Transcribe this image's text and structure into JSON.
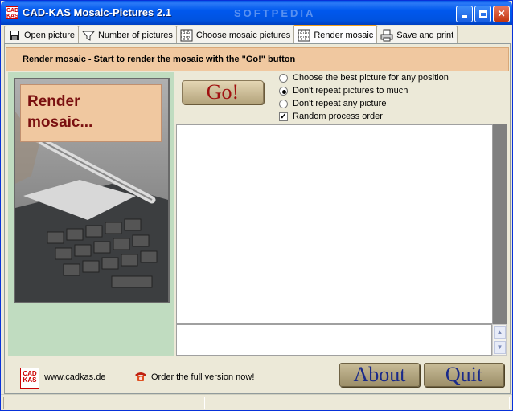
{
  "window": {
    "title": "CAD-KAS Mosaic-Pictures 2.1",
    "watermark": "SOFTPEDIA"
  },
  "app_icon": {
    "label": "CAD KAS"
  },
  "tabs": [
    {
      "label": "Open picture",
      "icon": "floppy-icon",
      "active": false
    },
    {
      "label": "Number of pictures",
      "icon": "funnel-icon",
      "active": false
    },
    {
      "label": "Choose mosaic pictures",
      "icon": "mosaic-grid-icon",
      "active": false
    },
    {
      "label": "Render mosaic",
      "icon": "mosaic-grid-icon",
      "active": true
    },
    {
      "label": "Save and print",
      "icon": "printer-icon",
      "active": false
    }
  ],
  "banner": {
    "text": "Render mosaic - Start to render the mosaic with the \"Go!\" button"
  },
  "preview": {
    "title_line1": "Render",
    "title_line2": "mosaic..."
  },
  "go_button": {
    "label": "Go!"
  },
  "options": [
    {
      "label": "Choose the best picture for any position",
      "type": "radio",
      "checked": false
    },
    {
      "label": "Don't repeat pictures to much",
      "type": "radio",
      "checked": true
    },
    {
      "label": "Don't repeat any picture",
      "type": "radio",
      "checked": false
    },
    {
      "label": "Random process order",
      "type": "checkbox",
      "checked": true
    }
  ],
  "footer": {
    "logo": "CAD KAS",
    "website": "www.cadkas.de",
    "order": "Order the full version now!"
  },
  "buttons": {
    "about": "About",
    "quit": "Quit"
  },
  "colors": {
    "banner_bg": "#f0c8a0",
    "left_pane_bg": "#c0dcc0",
    "titlebar": "#0058ee",
    "button_text": "#1a2a8a"
  }
}
